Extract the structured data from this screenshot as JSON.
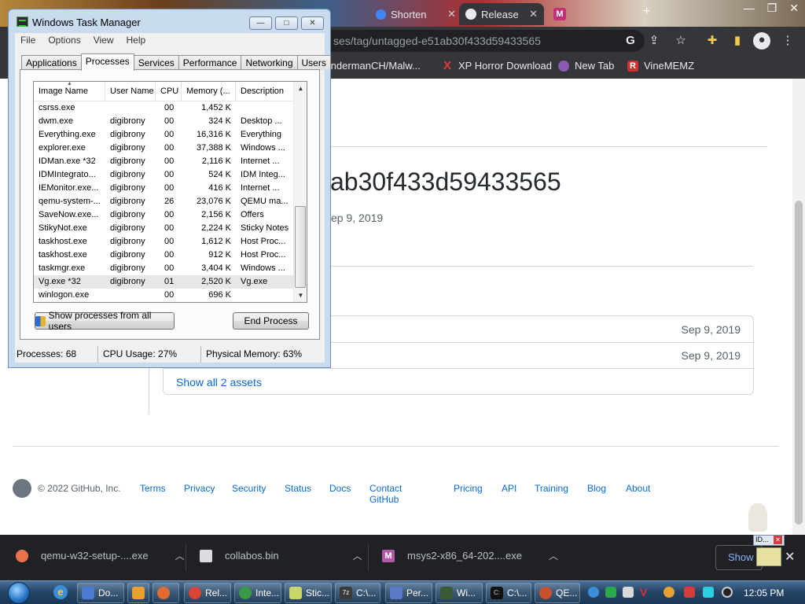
{
  "browser": {
    "tabs": [
      {
        "label": "Shorten"
      },
      {
        "label": "Release"
      }
    ],
    "address": "ses/tag/untagged-e51ab30f433d59433565",
    "bookmarks": [
      {
        "label": "EndermanCH/Malw..."
      },
      {
        "label": "XP Horror Download"
      },
      {
        "label": "New Tab"
      },
      {
        "label": "VineMEMZ"
      }
    ]
  },
  "github": {
    "heading": "ab30f433d59433565",
    "date_line": "ep 9, 2019",
    "assets": [
      {
        "date": "Sep 9, 2019"
      },
      {
        "date": "Sep 9, 2019"
      }
    ],
    "show_all": "Show all 2 assets",
    "footer": {
      "copyright": "© 2022 GitHub, Inc.",
      "links": [
        "Terms",
        "Privacy",
        "Security",
        "Status",
        "Docs",
        "Contact GitHub",
        "Pricing",
        "API",
        "Training",
        "Blog",
        "About"
      ]
    }
  },
  "downloads": {
    "items": [
      {
        "name": "qemu-w32-setup-....exe",
        "color": "#e8734a"
      },
      {
        "name": "collabos.bin",
        "color": "#dadce0"
      },
      {
        "name": "msys2-x86_64-202....exe",
        "color": "#b05aa8"
      }
    ],
    "show_all": "Show"
  },
  "taskbar": {
    "buttons": [
      {
        "label": "Do...",
        "color": "#4a7bd0"
      },
      {
        "label": "",
        "color": "#e8a030"
      },
      {
        "label": "",
        "color": "#e06a30"
      },
      {
        "label": "Rel...",
        "color": "#db4437"
      },
      {
        "label": "Inte...",
        "color": "#3a9a4a"
      },
      {
        "label": "Stic...",
        "color": "#c9d66a"
      },
      {
        "label": "C:\\...",
        "color": "#3a3a3a"
      },
      {
        "label": "Per...",
        "color": "#5a7ac8"
      },
      {
        "label": "Wi...",
        "color": "#3a5a3a"
      },
      {
        "label": "C:\\...",
        "color": "#111111"
      },
      {
        "label": "QE...",
        "color": "#c8502a"
      }
    ],
    "clock": "12:05 PM"
  },
  "taskmgr": {
    "title": "Windows Task Manager",
    "menu": [
      "File",
      "Options",
      "View",
      "Help"
    ],
    "tabs": [
      "Applications",
      "Processes",
      "Services",
      "Performance",
      "Networking",
      "Users"
    ],
    "selected_tab": "Processes",
    "columns": [
      "Image Name",
      "User Name",
      "CPU",
      "Memory (...",
      "Description"
    ],
    "rows": [
      {
        "image": "csrss.exe",
        "user": "",
        "cpu": "00",
        "mem": "1,452 K",
        "desc": ""
      },
      {
        "image": "dwm.exe",
        "user": "digibrony",
        "cpu": "00",
        "mem": "324 K",
        "desc": "Desktop ..."
      },
      {
        "image": "Everything.exe",
        "user": "digibrony",
        "cpu": "00",
        "mem": "16,316 K",
        "desc": "Everything"
      },
      {
        "image": "explorer.exe",
        "user": "digibrony",
        "cpu": "00",
        "mem": "37,388 K",
        "desc": "Windows ..."
      },
      {
        "image": "IDMan.exe *32",
        "user": "digibrony",
        "cpu": "00",
        "mem": "2,116 K",
        "desc": "Internet ..."
      },
      {
        "image": "IDMIntegrato...",
        "user": "digibrony",
        "cpu": "00",
        "mem": "524 K",
        "desc": "IDM Integ..."
      },
      {
        "image": "IEMonitor.exe...",
        "user": "digibrony",
        "cpu": "00",
        "mem": "416 K",
        "desc": "Internet ..."
      },
      {
        "image": "qemu-system-...",
        "user": "digibrony",
        "cpu": "26",
        "mem": "23,076 K",
        "desc": "QEMU ma..."
      },
      {
        "image": "SaveNow.exe...",
        "user": "digibrony",
        "cpu": "00",
        "mem": "2,156 K",
        "desc": "Offers"
      },
      {
        "image": "StikyNot.exe",
        "user": "digibrony",
        "cpu": "00",
        "mem": "2,224 K",
        "desc": "Sticky Notes"
      },
      {
        "image": "taskhost.exe",
        "user": "digibrony",
        "cpu": "00",
        "mem": "1,612 K",
        "desc": "Host Proc..."
      },
      {
        "image": "taskhost.exe",
        "user": "digibrony",
        "cpu": "00",
        "mem": "912 K",
        "desc": "Host Proc..."
      },
      {
        "image": "taskmgr.exe",
        "user": "digibrony",
        "cpu": "00",
        "mem": "3,404 K",
        "desc": "Windows ..."
      },
      {
        "image": "Vg.exe *32",
        "user": "digibrony",
        "cpu": "01",
        "mem": "2,520 K",
        "desc": "Vg.exe",
        "selected": true
      },
      {
        "image": "winlogon.exe",
        "user": "",
        "cpu": "00",
        "mem": "696 K",
        "desc": ""
      }
    ],
    "show_all_button": "Show processes from all users",
    "end_button": "End Process",
    "status": {
      "processes": "Processes: 68",
      "cpu": "CPU Usage: 27%",
      "memory": "Physical Memory: 63%"
    }
  }
}
